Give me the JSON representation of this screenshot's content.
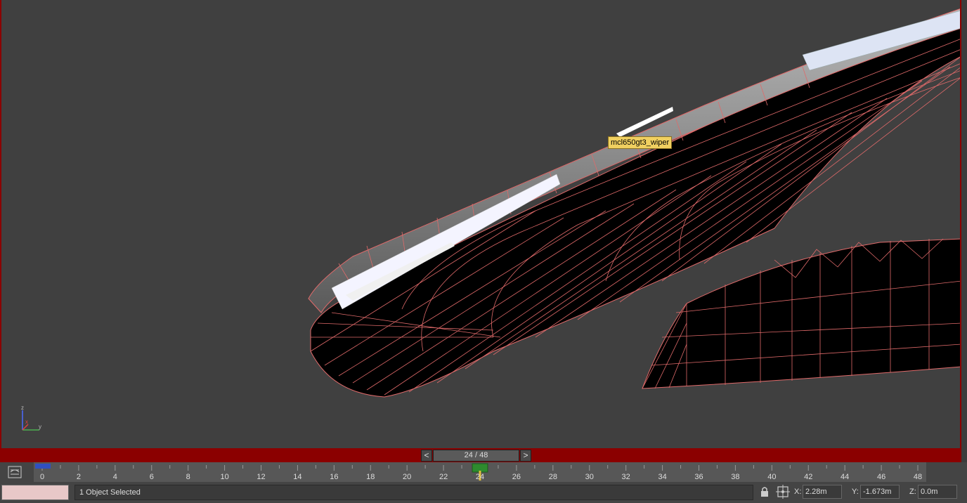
{
  "viewport": {
    "tooltip": "mcl650gt3_wiper",
    "axis_labels": {
      "z": "z",
      "y": "y",
      "x": "x"
    },
    "colors": {
      "wire": "#e06a6a",
      "border": "#8b0000",
      "background": "#404040"
    }
  },
  "frame_slider": {
    "prev_label": "<",
    "next_label": ">",
    "readout": "24 / 48",
    "current_frame": 24,
    "total_frames": 48
  },
  "timeline": {
    "tick_labels": [
      "0",
      "2",
      "4",
      "6",
      "8",
      "10",
      "12",
      "14",
      "16",
      "18",
      "20",
      "22",
      "24",
      "26",
      "28",
      "30",
      "32",
      "34",
      "36",
      "38",
      "40",
      "42",
      "44",
      "46",
      "48"
    ]
  },
  "status": {
    "selection": "1 Object Selected",
    "x_label": "X:",
    "x_value": "2.28m",
    "y_label": "Y:",
    "y_value": "-1.673m",
    "z_label": "Z:",
    "z_value": "0.0m"
  }
}
